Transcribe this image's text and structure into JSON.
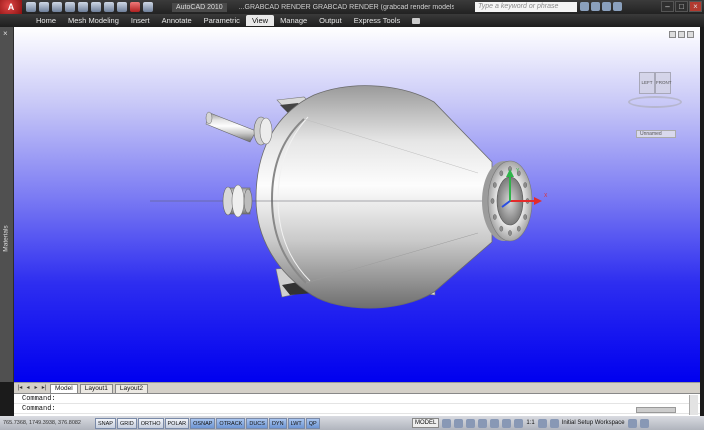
{
  "title_bar": {
    "app_button": "A",
    "app_title": "AutoCAD 2010",
    "doc_title": "...GRABCAD RENDER GRABCAD RENDER (grabcad render models) VIEWSPACE.dwg",
    "search_placeholder": "Type a keyword or phrase"
  },
  "ribbon": {
    "tabs": [
      {
        "label": "Home"
      },
      {
        "label": "Mesh Modeling"
      },
      {
        "label": "Insert"
      },
      {
        "label": "Annotate"
      },
      {
        "label": "Parametric"
      },
      {
        "label": "View",
        "active": true
      },
      {
        "label": "Manage"
      },
      {
        "label": "Output"
      },
      {
        "label": "Express Tools"
      }
    ]
  },
  "palette": {
    "label": "Materials"
  },
  "viewport": {
    "background": [
      "#ffffff",
      "#0000ef"
    ],
    "viewcube": {
      "left_face": "LEFT",
      "right_face": "FRONT"
    },
    "ucs_menu": "Unnamed"
  },
  "layout_tabs": [
    {
      "label": "Model",
      "active": true
    },
    {
      "label": "Layout1"
    },
    {
      "label": "Layout2"
    }
  ],
  "command_line": {
    "rows": [
      "Command:",
      "Command:"
    ]
  },
  "status_bar": {
    "coords": "765.7368, 1749.3938, 376.8082",
    "toggles": [
      {
        "label": "SNAP"
      },
      {
        "label": "GRID"
      },
      {
        "label": "ORTHO"
      },
      {
        "label": "POLAR"
      },
      {
        "label": "OSNAP",
        "on": true
      },
      {
        "label": "OTRACK",
        "on": true
      },
      {
        "label": "DUCS",
        "on": true
      },
      {
        "label": "DYN",
        "on": true
      },
      {
        "label": "LWT",
        "on": true
      },
      {
        "label": "QP",
        "on": true
      }
    ],
    "model_label": "MODEL",
    "scale": "1:1",
    "workspace": "Initial Setup Workspace"
  },
  "colors": {
    "ucs_x": "#e32b2b",
    "ucs_y": "#2fb34a",
    "ucs_z": "#2b4fe3"
  }
}
